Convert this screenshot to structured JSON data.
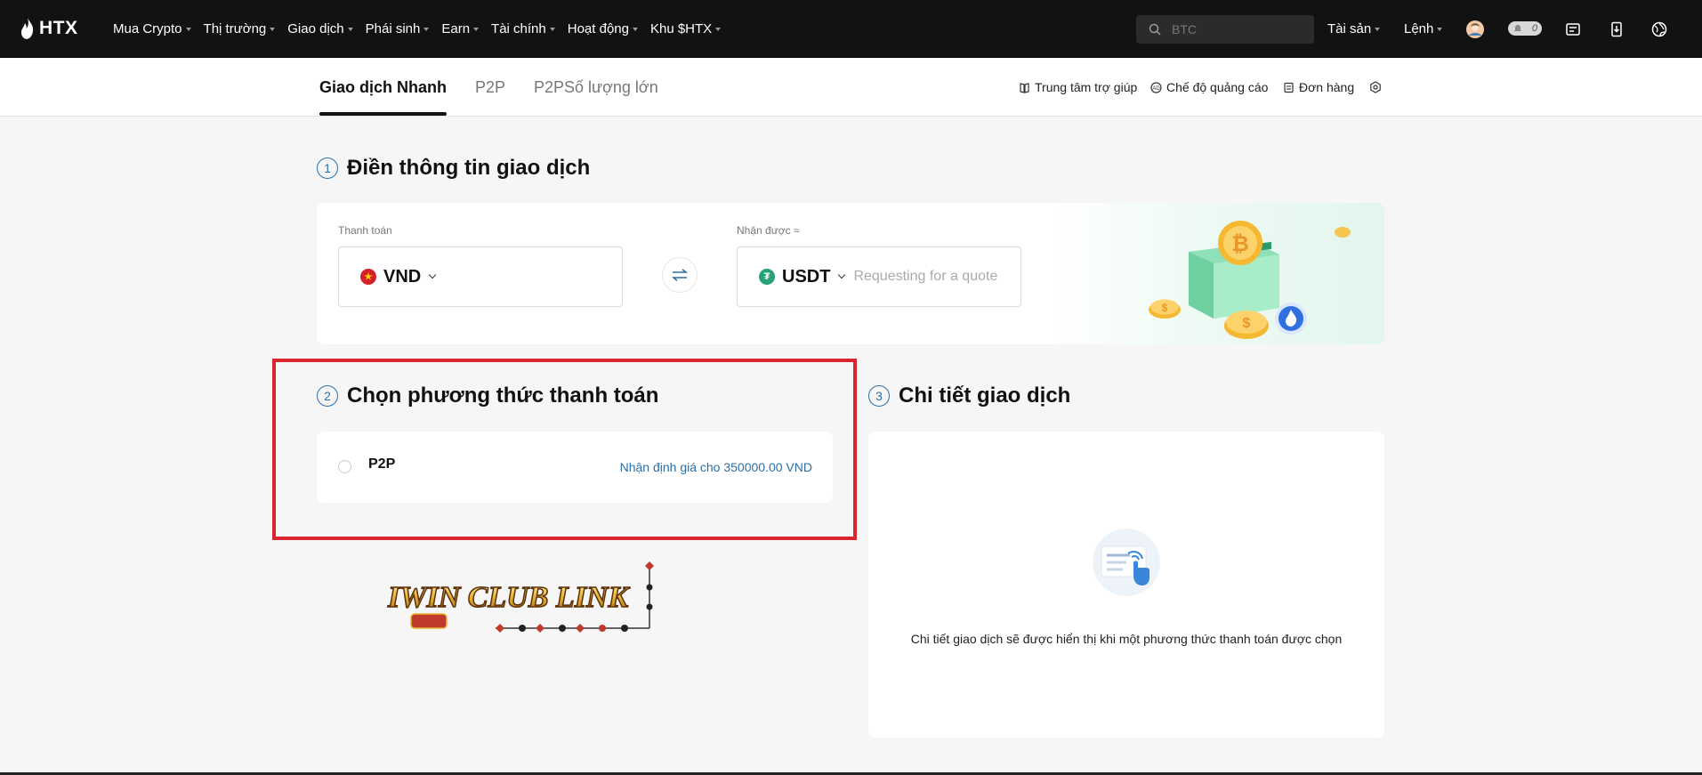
{
  "brand": {
    "logo_text": "HTX"
  },
  "nav": {
    "items": [
      "Mua Crypto",
      "Thị trường",
      "Giao dịch",
      "Phái sinh",
      "Earn",
      "Tài chính",
      "Hoạt động",
      "Khu $HTX"
    ]
  },
  "search": {
    "placeholder": "BTC"
  },
  "topbar_right": {
    "assets": "Tài sản",
    "orders": "Lệnh",
    "notification_count": "0"
  },
  "tabs": [
    "Giao dịch Nhanh",
    "P2P",
    "P2PSố lượng lớn"
  ],
  "subheader_links": {
    "help": "Trung tâm trợ giúp",
    "ad_mode": "Chế độ quảng cáo",
    "orders": "Đơn hàng"
  },
  "step1": {
    "num": "1",
    "title": "Điền thông tin giao dịch",
    "pay_label": "Thanh toán",
    "pay_currency": "VND",
    "receive_label": "Nhận được ≈",
    "receive_currency": "USDT",
    "receive_placeholder": "Requesting for a quote"
  },
  "step2": {
    "num": "2",
    "title": "Chọn phương thức thanh toán",
    "method_name": "P2P",
    "method_quote": "Nhận định giá cho 350000.00 VND"
  },
  "step3": {
    "num": "3",
    "title": "Chi tiết giao dịch",
    "empty_text": "Chi tiết giao dịch sẽ được hiển thị khi một phương thức thanh toán được chọn"
  },
  "watermark": {
    "text": "IWIN CLUB LINK"
  },
  "colors": {
    "accent_blue": "#2b6fa8",
    "highlight_red": "#d8252f",
    "topbar": "#121212",
    "usdt_green": "#26a17b"
  }
}
